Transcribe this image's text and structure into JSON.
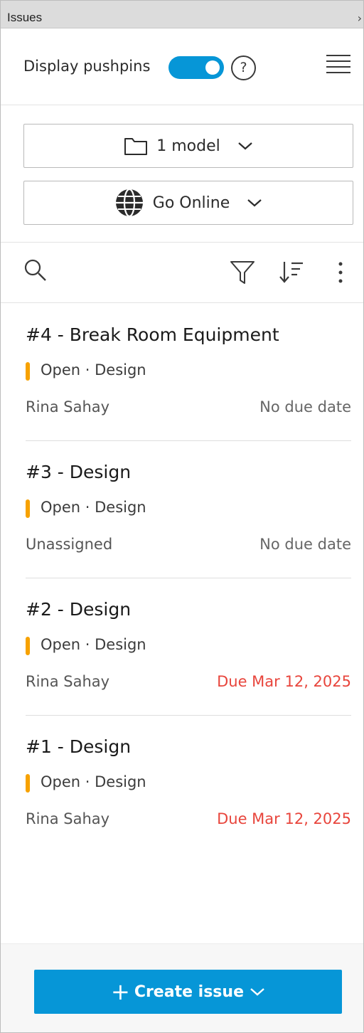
{
  "panel": {
    "title": "Issues",
    "collapse_glyph": "›"
  },
  "pushpins": {
    "label": "Display pushpins",
    "enabled": true,
    "help_glyph": "?"
  },
  "selectors": {
    "model": {
      "label": "1 model",
      "icon": "folder-icon"
    },
    "mode": {
      "label": "Go Online",
      "icon": "globe-icon"
    }
  },
  "toolbar": {
    "icons": [
      "search-icon",
      "filter-icon",
      "sort-icon",
      "more-vertical-icon"
    ]
  },
  "issues": [
    {
      "title": "#4 - Break Room Equipment",
      "status": "Open · Design",
      "assignee": "Rina Sahay",
      "due": "No due date",
      "overdue": false
    },
    {
      "title": "#3 - Design",
      "status": "Open · Design",
      "assignee": "Unassigned",
      "due": "No due date",
      "overdue": false
    },
    {
      "title": "#2 - Design",
      "status": "Open · Design",
      "assignee": "Rina Sahay",
      "due": "Due Mar 12, 2025",
      "overdue": true
    },
    {
      "title": "#1 - Design",
      "status": "Open · Design",
      "assignee": "Rina Sahay",
      "due": "Due Mar 12, 2025",
      "overdue": true
    }
  ],
  "footer": {
    "create_label": "Create issue"
  },
  "colors": {
    "accent": "#0696d7",
    "status_open": "#f7a200",
    "overdue": "#e8453c"
  }
}
